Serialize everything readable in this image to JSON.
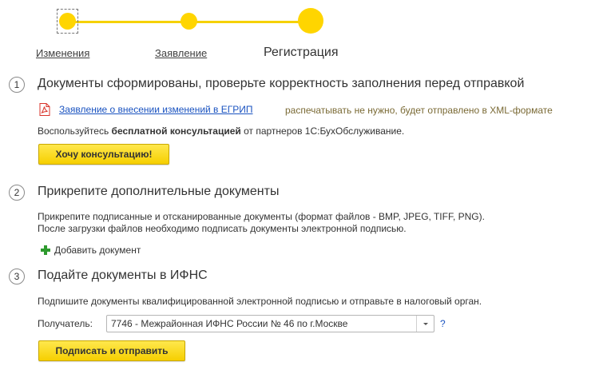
{
  "stepper": {
    "steps": [
      {
        "label": "Изменения",
        "state": "done"
      },
      {
        "label": "Заявление",
        "state": "done"
      },
      {
        "label": "Регистрация",
        "state": "current"
      }
    ],
    "accent": "#ffd500"
  },
  "section1": {
    "number": "1",
    "title": "Документы сформированы, проверьте корректность заполнения перед отправкой",
    "document_link": "Заявление о внесении изменений в ЕГРИП",
    "document_note": "распечатывать не нужно, будет отправлено в XML-формате",
    "consult_before": "Воспользуйтесь ",
    "consult_bold": "бесплатной консультацией",
    "consult_after": " от партнеров 1С:БухОбслуживание.",
    "consult_button": "Хочу консультацию!"
  },
  "section2": {
    "number": "2",
    "title": "Прикрепите дополнительные документы",
    "line1": "Прикрепите подписанные и отсканированные документы (формат файлов - BMP, JPEG, TIFF, PNG).",
    "line2": "После загрузки файлов необходимо подписать документы электронной подписью.",
    "add_label": "Добавить документ"
  },
  "section3": {
    "number": "3",
    "title": "Подайте документы в ИФНС",
    "instruction": "Подпишите документы квалифицированной электронной подписью и отправьте в налоговый орган.",
    "recipient_label": "Получатель:",
    "recipient_value": "7746 - Межрайонная ИФНС России № 46 по г.Москве",
    "help": "?",
    "submit_button": "Подписать и отправить"
  }
}
